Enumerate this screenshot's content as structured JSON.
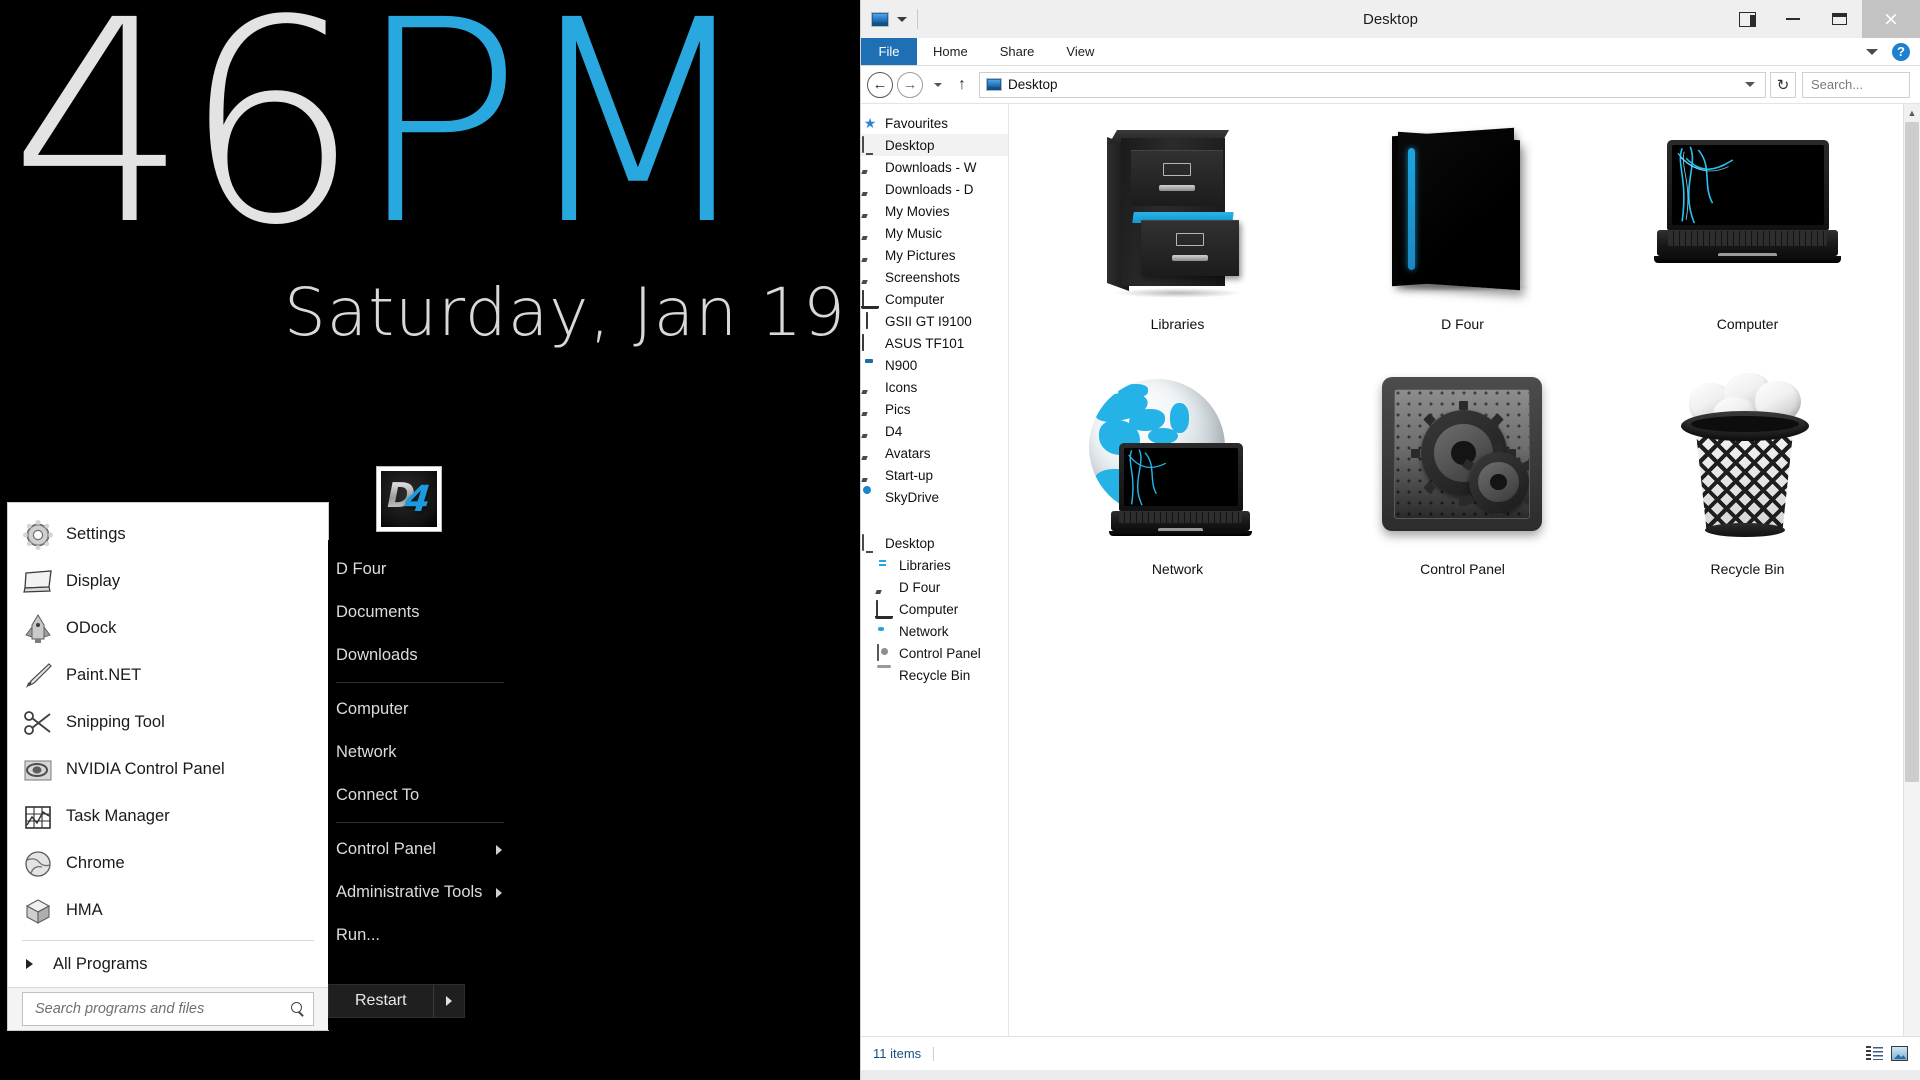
{
  "desktop": {
    "clock": {
      "time": "46",
      "ampm": "PM",
      "date": "Saturday, Jan 19"
    },
    "avatar": {
      "name": "D4",
      "letter": "D",
      "digit": "4"
    }
  },
  "start_menu": {
    "programs": [
      {
        "label": "Settings",
        "icon": "gear-icon"
      },
      {
        "label": "Display",
        "icon": "monitor-icon"
      },
      {
        "label": "ODock",
        "icon": "odock-icon"
      },
      {
        "label": "Paint.NET",
        "icon": "paintbrush-icon"
      },
      {
        "label": "Snipping Tool",
        "icon": "scissors-icon"
      },
      {
        "label": "NVIDIA Control Panel",
        "icon": "nvidia-eye-icon"
      },
      {
        "label": "Task Manager",
        "icon": "chart-grid-icon"
      },
      {
        "label": "Chrome",
        "icon": "globe-icon"
      },
      {
        "label": "HMA",
        "icon": "cube-icon"
      }
    ],
    "all_programs": "All Programs",
    "search": {
      "placeholder": "Search programs and files",
      "value": ""
    },
    "right_items": [
      {
        "label": "D Four",
        "submenu": false,
        "separator_after": false
      },
      {
        "label": "Documents",
        "submenu": false,
        "separator_after": false
      },
      {
        "label": "Downloads",
        "submenu": false,
        "separator_after": true
      },
      {
        "label": "Computer",
        "submenu": false,
        "separator_after": false
      },
      {
        "label": "Network",
        "submenu": false,
        "separator_after": false
      },
      {
        "label": "Connect To",
        "submenu": false,
        "separator_after": true
      },
      {
        "label": "Control Panel",
        "submenu": true,
        "separator_after": false
      },
      {
        "label": "Administrative Tools",
        "submenu": true,
        "separator_after": false
      },
      {
        "label": "Run...",
        "submenu": false,
        "separator_after": false
      }
    ],
    "power": {
      "label": "Restart"
    }
  },
  "explorer": {
    "title": "Desktop",
    "window_controls": {
      "ribbon_toggle": "minimize-ribbon-icon",
      "minimize": "minimize-icon",
      "maximize": "maximize-icon",
      "close": "×"
    },
    "ribbon_tabs": [
      {
        "label": "File",
        "active": true
      },
      {
        "label": "Home",
        "active": false
      },
      {
        "label": "Share",
        "active": false
      },
      {
        "label": "View",
        "active": false
      }
    ],
    "ribbon_help": "?",
    "address": {
      "back": "←",
      "forward": "→",
      "up": "↑",
      "path": "Desktop",
      "refresh": "↻"
    },
    "search": {
      "placeholder": "Search...",
      "value": ""
    },
    "nav_pane": {
      "favourites": {
        "label": "Favourites",
        "icon": "star-icon"
      },
      "favourites_items": [
        {
          "label": "Desktop",
          "icon": "monitor-icon",
          "selected": true
        },
        {
          "label": "Downloads - W",
          "icon": "folder-icon",
          "selected": false
        },
        {
          "label": "Downloads - D",
          "icon": "folder-icon",
          "selected": false
        },
        {
          "label": "My Movies",
          "icon": "folder-icon",
          "selected": false
        },
        {
          "label": "My Music",
          "icon": "folder-icon",
          "selected": false
        },
        {
          "label": "My Pictures",
          "icon": "folder-icon",
          "selected": false
        },
        {
          "label": "Screenshots",
          "icon": "folder-icon",
          "selected": false
        },
        {
          "label": "Computer",
          "icon": "laptop-icon",
          "selected": false
        },
        {
          "label": "GSII GT I9100",
          "icon": "phone-icon",
          "selected": false
        },
        {
          "label": "ASUS TF101",
          "icon": "tablet-icon",
          "selected": false
        },
        {
          "label": "N900",
          "icon": "n900-icon",
          "selected": false
        },
        {
          "label": "Icons",
          "icon": "folder-icon",
          "selected": false
        },
        {
          "label": "Pics",
          "icon": "folder-icon",
          "selected": false
        },
        {
          "label": "D4",
          "icon": "folder-icon",
          "selected": false
        },
        {
          "label": "Avatars",
          "icon": "folder-icon",
          "selected": false
        },
        {
          "label": "Start-up",
          "icon": "folder-icon",
          "selected": false
        },
        {
          "label": "SkyDrive",
          "icon": "cloud-icon",
          "selected": false
        }
      ],
      "tree_root": {
        "label": "Desktop",
        "icon": "monitor-icon"
      },
      "tree_items": [
        {
          "label": "Libraries",
          "icon": "library-icon"
        },
        {
          "label": "D Four",
          "icon": "folder-icon"
        },
        {
          "label": "Computer",
          "icon": "laptop-icon"
        },
        {
          "label": "Network",
          "icon": "globe-icon"
        },
        {
          "label": "Control Panel",
          "icon": "control-panel-icon"
        },
        {
          "label": "Recycle Bin",
          "icon": "recycle-bin-icon"
        }
      ]
    },
    "desktop_icons": [
      {
        "label": "Libraries",
        "art": "filing-cabinet"
      },
      {
        "label": "D Four",
        "art": "black-folder"
      },
      {
        "label": "Computer",
        "art": "laptop"
      },
      {
        "label": "Network",
        "art": "globe-laptop"
      },
      {
        "label": "Control Panel",
        "art": "gears"
      },
      {
        "label": "Recycle Bin",
        "art": "wastebasket"
      }
    ],
    "status": {
      "items_count": "11 items"
    },
    "view_buttons": [
      {
        "name": "details-view",
        "label": "Details view"
      },
      {
        "name": "large-icons-view",
        "label": "Large icons view"
      }
    ]
  },
  "colors": {
    "accent_cyan": "#29a8e0",
    "file_tab_blue": "#1f6fb5",
    "selection": "#e9f3fb"
  }
}
